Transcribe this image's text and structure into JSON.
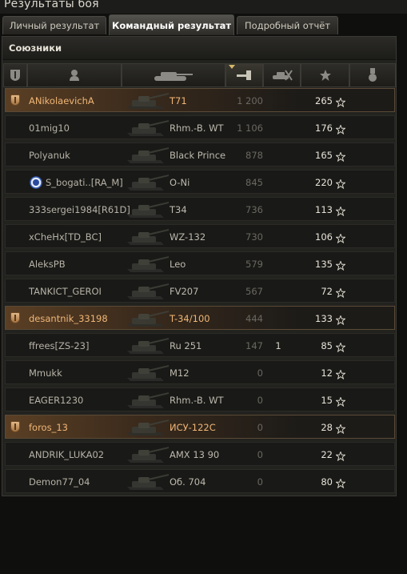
{
  "window": {
    "title": "Результаты боя"
  },
  "tabs": [
    {
      "label": "Личный результат",
      "active": false
    },
    {
      "label": "Командный результат",
      "active": true
    },
    {
      "label": "Подробный отчёт",
      "active": false
    }
  ],
  "team": {
    "title": "Союзники"
  },
  "columns": [
    {
      "icon": "platoon-icon"
    },
    {
      "icon": "player-icon"
    },
    {
      "icon": "tank-icon"
    },
    {
      "icon": "damage-icon",
      "sorted": true
    },
    {
      "icon": "kills-icon"
    },
    {
      "icon": "xp-star-icon"
    },
    {
      "icon": "medal-icon"
    }
  ],
  "rows": [
    {
      "platoon": true,
      "player": "ANikolaevichA",
      "tank": "T71",
      "damage": "1 200",
      "frags": "",
      "xp": "265",
      "highlight": true
    },
    {
      "platoon": false,
      "player": "01mig10",
      "tank": "Rhm.-B. WT",
      "damage": "1 106",
      "frags": "",
      "xp": "176"
    },
    {
      "platoon": false,
      "player": "Polyanuk",
      "tank": "Black Prince",
      "damage": "878",
      "frags": "",
      "xp": "165"
    },
    {
      "platoon": false,
      "player": "S_bogati..[RA_M]",
      "tank": "O-Ni",
      "damage": "845",
      "frags": "",
      "xp": "220",
      "clan_badge": true
    },
    {
      "platoon": false,
      "player": "333sergei1984[R61D]",
      "tank": "T34",
      "damage": "736",
      "frags": "",
      "xp": "113"
    },
    {
      "platoon": false,
      "player": "xCheHx[TD_BC]",
      "tank": "WZ-132",
      "damage": "730",
      "frags": "",
      "xp": "106"
    },
    {
      "platoon": false,
      "player": "AleksPB",
      "tank": "Leo",
      "damage": "579",
      "frags": "",
      "xp": "135"
    },
    {
      "platoon": false,
      "player": "TANKICT_GEROI",
      "tank": "FV207",
      "damage": "567",
      "frags": "",
      "xp": "72"
    },
    {
      "platoon": true,
      "player": "desantnik_33198",
      "tank": "T-34/100",
      "damage": "444",
      "frags": "",
      "xp": "133",
      "highlight": true
    },
    {
      "platoon": false,
      "player": "ffrees[ZS-23]",
      "tank": "Ru 251",
      "damage": "147",
      "frags": "1",
      "xp": "85"
    },
    {
      "platoon": false,
      "player": "Mmukk",
      "tank": "M12",
      "damage": "0",
      "frags": "",
      "xp": "12"
    },
    {
      "platoon": false,
      "player": "EAGER1230",
      "tank": "Rhm.-B. WT",
      "damage": "0",
      "frags": "",
      "xp": "15"
    },
    {
      "platoon": true,
      "player": "foros_13",
      "tank": "ИСУ-122С",
      "damage": "0",
      "frags": "",
      "xp": "28",
      "highlight": true
    },
    {
      "platoon": false,
      "player": "ANDRIK_LUKA02",
      "tank": "AMX 13 90",
      "damage": "0",
      "frags": "",
      "xp": "22"
    },
    {
      "platoon": false,
      "player": "Demon77_04",
      "tank": "Об. 704",
      "damage": "0",
      "frags": "",
      "xp": "80"
    }
  ],
  "colors": {
    "accent": "#f0b676",
    "highlight_row": "#5a3f24",
    "background": "#22221f"
  }
}
